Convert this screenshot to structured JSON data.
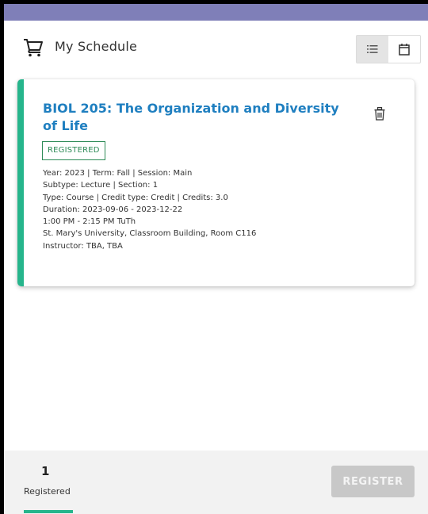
{
  "header": {
    "title": "My Schedule",
    "icons": {
      "cart": "cart-icon",
      "list_view": "list-icon",
      "calendar_view": "calendar-icon"
    }
  },
  "course": {
    "title": "BIOL 205: The Organization and Diversity of Life",
    "status": "REGISTERED",
    "details": [
      "Year: 2023 | Term: Fall | Session: Main",
      "Subtype: Lecture | Section: 1",
      "Type: Course | Credit type: Credit | Credits: 3.0",
      "Duration: 2023-09-06 - 2023-12-22",
      "1:00 PM - 2:15 PM TuTh",
      "St. Mary's University, Classroom Building, Room C116",
      "Instructor: TBA, TBA"
    ],
    "icons": {
      "delete": "trash-icon"
    }
  },
  "footer": {
    "count": "1",
    "count_label": "Registered",
    "register_label": "REGISTER"
  },
  "colors": {
    "top_band": "#7f7fb8",
    "accent": "#26b58c",
    "title_link": "#1f7fc0",
    "badge": "#2e8b57",
    "button_disabled": "#c8c8c8"
  }
}
